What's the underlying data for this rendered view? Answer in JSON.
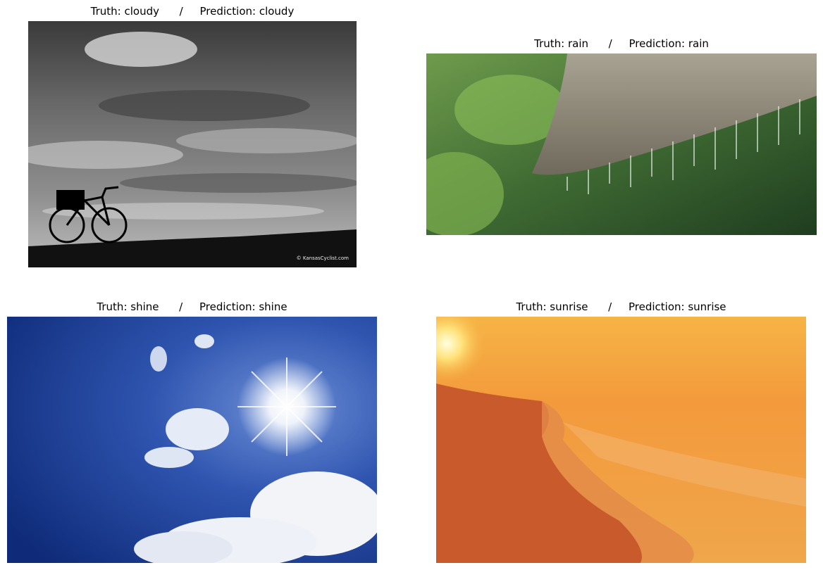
{
  "figure": {
    "panels": [
      {
        "title": "Truth: cloudy      /     Prediction: cloudy",
        "truth": "cloudy",
        "prediction": "cloudy",
        "image_caption": "© KansasCyclist.com"
      },
      {
        "title": "Truth: rain      /     Prediction: rain",
        "truth": "rain",
        "prediction": "rain"
      },
      {
        "title": "Truth: shine      /     Prediction: shine",
        "truth": "shine",
        "prediction": "shine"
      },
      {
        "title": "Truth: sunrise      /     Prediction: sunrise",
        "truth": "sunrise",
        "prediction": "sunrise"
      }
    ]
  }
}
